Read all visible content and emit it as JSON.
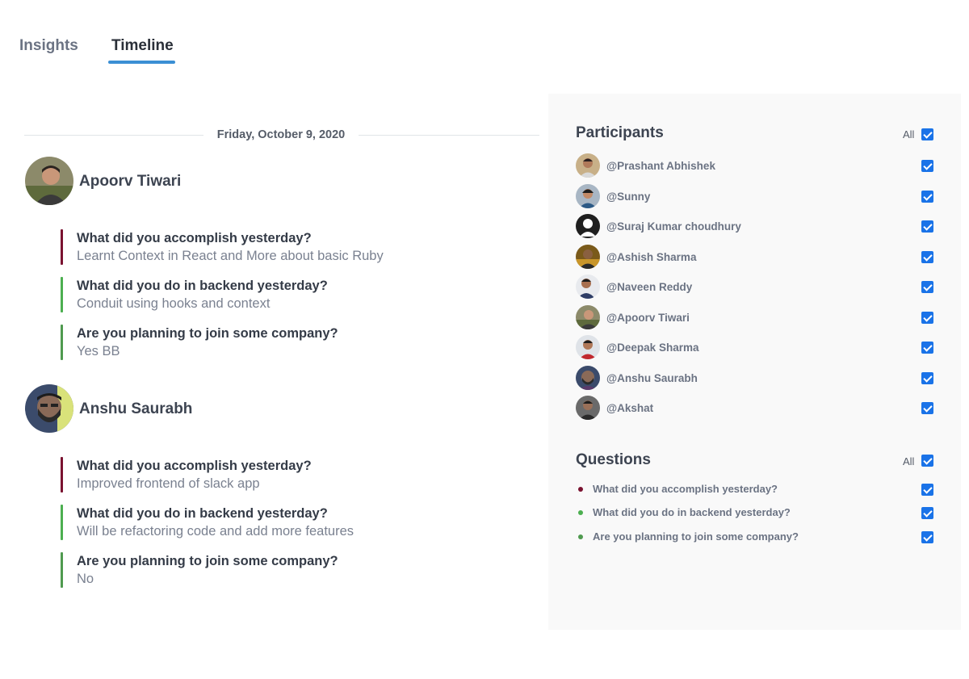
{
  "tabs": {
    "insights": "Insights",
    "timeline": "Timeline",
    "active": "Timeline"
  },
  "timeline": {
    "date": "Friday, October 9, 2020",
    "entries": [
      {
        "name": "Apoorv Tiwari",
        "answers": [
          {
            "question": "What did you accomplish yesterday?",
            "answer": "Learnt Context in React and More about basic Ruby",
            "color": "#7a1230"
          },
          {
            "question": "What did you do in backend yesterday?",
            "answer": "Conduit using hooks and context",
            "color": "#4caf50"
          },
          {
            "question": "Are you planning to join some company?",
            "answer": "Yes BB",
            "color": "#4f9a4f"
          }
        ]
      },
      {
        "name": "Anshu Saurabh",
        "answers": [
          {
            "question": "What did you accomplish yesterday?",
            "answer": "Improved frontend of slack app",
            "color": "#7a1230"
          },
          {
            "question": "What did you do in backend yesterday?",
            "answer": "Will be refactoring code and add more features",
            "color": "#4caf50"
          },
          {
            "question": "Are you planning to join some company?",
            "answer": "No",
            "color": "#4f9a4f"
          }
        ]
      }
    ]
  },
  "panel": {
    "participants_title": "Participants",
    "questions_title": "Questions",
    "all_label": "All",
    "participants": [
      {
        "handle": "@Prashant Abhishek",
        "checked": true
      },
      {
        "handle": "@Sunny",
        "checked": true
      },
      {
        "handle": "@Suraj Kumar choudhury",
        "checked": true
      },
      {
        "handle": "@Ashish Sharma",
        "checked": true
      },
      {
        "handle": "@Naveen Reddy",
        "checked": true
      },
      {
        "handle": "@Apoorv Tiwari",
        "checked": true
      },
      {
        "handle": "@Deepak Sharma",
        "checked": true
      },
      {
        "handle": "@Anshu Saurabh",
        "checked": true
      },
      {
        "handle": "@Akshat",
        "checked": true
      }
    ],
    "questions": [
      {
        "text": "What did you accomplish yesterday?",
        "color": "#7a1230",
        "checked": true
      },
      {
        "text": "What did you do in backend yesterday?",
        "color": "#4caf50",
        "checked": true
      },
      {
        "text": "Are you planning to join some company?",
        "color": "#4f9a4f",
        "checked": true
      }
    ]
  },
  "colors": {
    "tab_underline": "#3b8fd4",
    "checkbox": "#1a73e8",
    "panel_background": "#f9f9f9"
  }
}
